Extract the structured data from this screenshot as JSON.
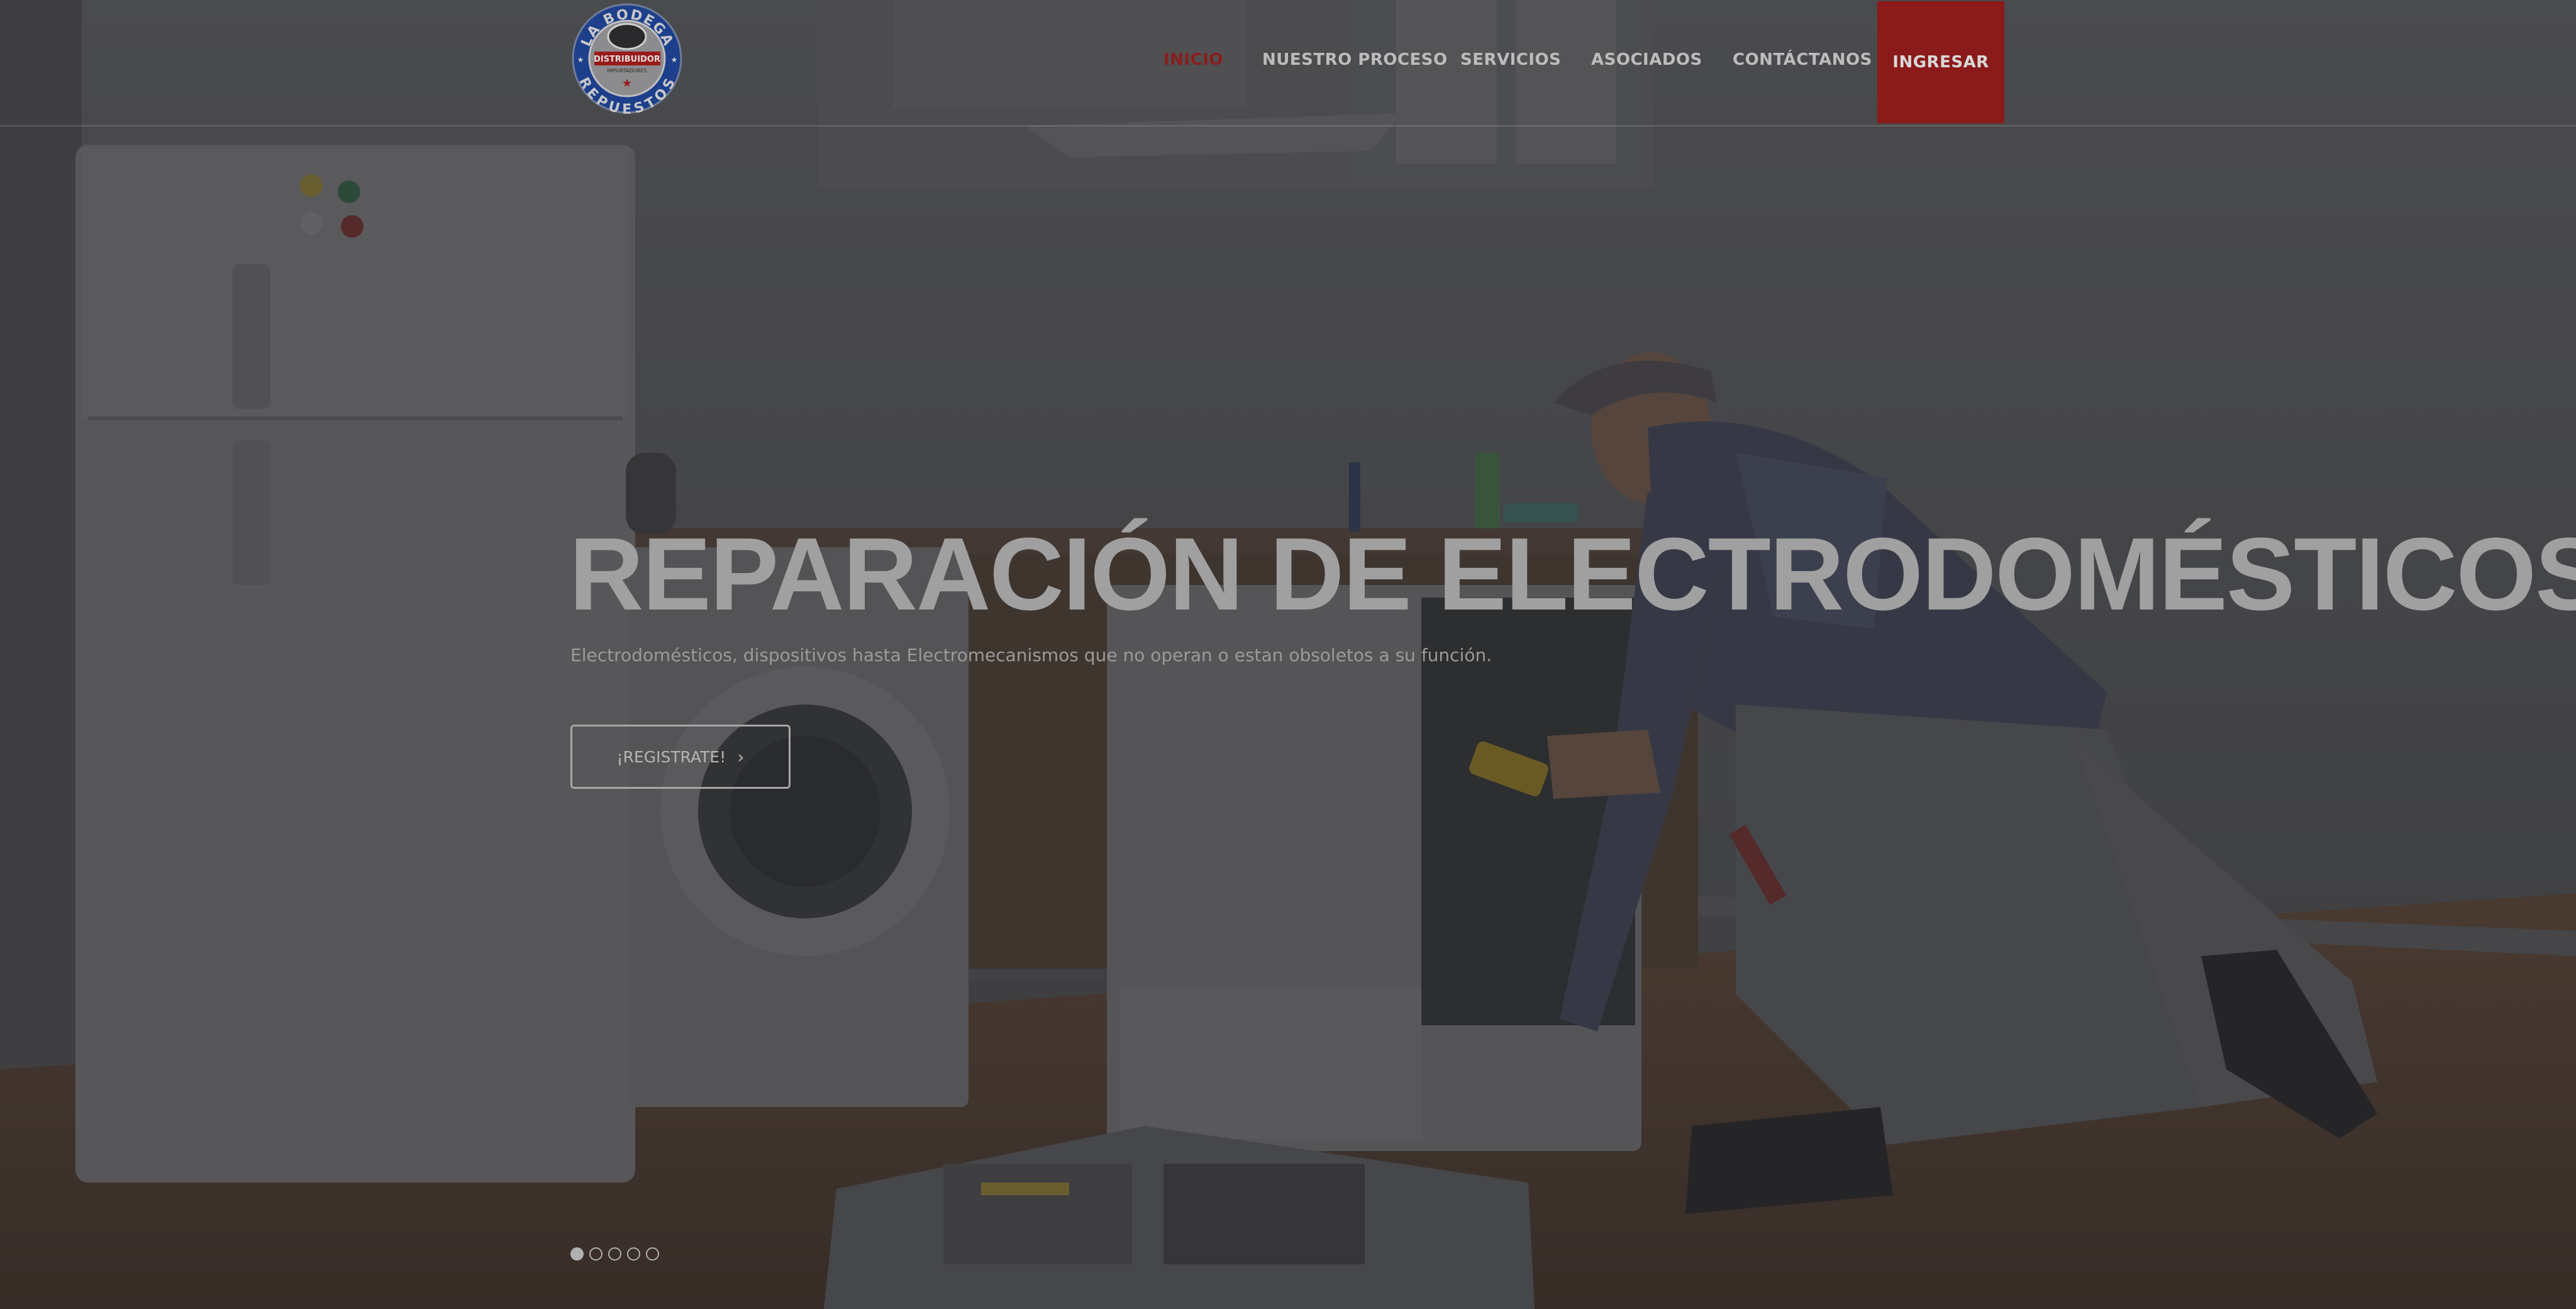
{
  "brand": {
    "logo_text_top": "LA BODEGA",
    "logo_text_bottom": "REPUESTOS",
    "logo_text_center": "DISTRIBUIDOR",
    "logo_text_small": "IMPORTADORES",
    "colors": {
      "ring": "#1d3f8c",
      "band": "#9a1a1a"
    }
  },
  "nav": {
    "items": [
      {
        "label": "INICIO",
        "active": true
      },
      {
        "label": "NUESTRO PROCESO",
        "active": false
      },
      {
        "label": "SERVICIOS",
        "active": false
      },
      {
        "label": "ASOCIADOS",
        "active": false
      },
      {
        "label": "CONTÁCTANOS",
        "active": false
      }
    ],
    "login_label": "INGRESAR"
  },
  "hero": {
    "title": "REPARACIÓN DE ELECTRODOMÉSTICOS",
    "subtitle": "Electrodomésticos, dispositivos hasta Electromecanismos que no operan o estan obsoletos a su función.",
    "cta_label": "¡REGISTRATE!",
    "cta_icon": "chevron-right-icon"
  },
  "slider": {
    "total_slides": 5,
    "active_slide": 1
  },
  "colors": {
    "accent": "#8b1a1a",
    "overlay": "#3f3f41"
  }
}
